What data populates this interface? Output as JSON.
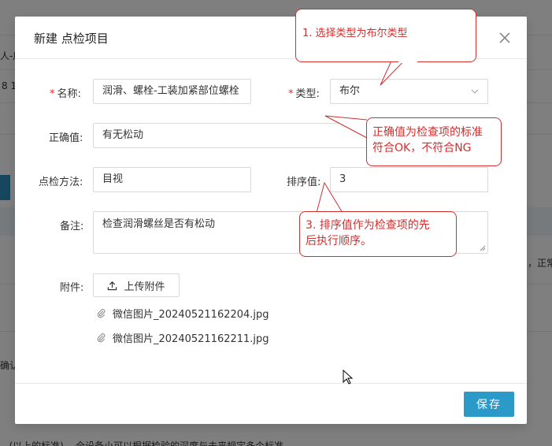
{
  "background": {
    "frag1": "人-后",
    "frag2": "8 1",
    "frag3": "，正常",
    "frag4": "确认",
    "frag5": "...(以上的标准)     ...全设备小可以根据检验的深度与未来规定多个标准"
  },
  "modal": {
    "title": "新建 点检项目",
    "fields": {
      "name": {
        "label": "名称:",
        "value": "润滑、螺栓-工装加紧部位螺栓",
        "required": true
      },
      "type": {
        "label": "类型:",
        "value": "布尔",
        "required": true
      },
      "correct_value": {
        "label": "正确值:",
        "value": "有无松动"
      },
      "method": {
        "label": "点检方法:",
        "value": "目视"
      },
      "sort_value": {
        "label": "排序值:",
        "value": "3"
      },
      "remark": {
        "label": "备注:",
        "value": "检查润滑螺丝是否有松动"
      }
    },
    "attachment": {
      "label": "附件:",
      "upload_label": "上传附件",
      "files": [
        "微信图片_20240521162204.jpg",
        "微信图片_20240521162211.jpg"
      ]
    },
    "save_label": "保存"
  },
  "callouts": {
    "c1": "1. 选择类型为布尔类型",
    "c2_line1": "正确值为检查项的标准",
    "c2_line2": "符合OK，不符合NG",
    "c3_line1": "3. 排序值作为检查项的先",
    "c3_line2": "后执行顺序。"
  },
  "colors": {
    "accent": "#2b9ac9",
    "required": "#f5222d",
    "callout": "#d32f2f"
  },
  "icons": [
    "close-icon",
    "chevron-down-icon",
    "upload-icon",
    "paperclip-icon",
    "cursor-icon"
  ]
}
